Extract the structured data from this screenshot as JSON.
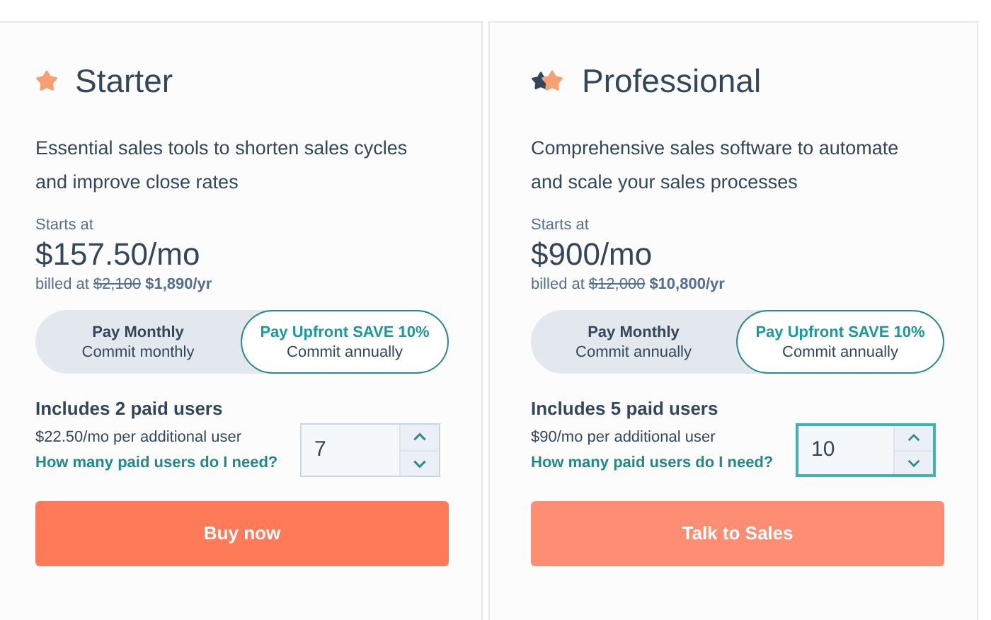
{
  "plans": [
    {
      "kind": "single",
      "name": "Starter",
      "description": "Essential sales tools to shorten sales cycles and improve close rates",
      "starts_label": "Starts at",
      "price": "$157.50/mo",
      "billed_label": "billed at",
      "old_price": "$2,100",
      "new_price": "$1,890/yr",
      "billing_options": [
        {
          "title": "Pay Monthly",
          "subtitle": "Commit monthly",
          "selected": false
        },
        {
          "title": "Pay Upfront SAVE 10%",
          "subtitle": "Commit annually",
          "selected": true
        }
      ],
      "includes": "Includes 2 paid users",
      "per_user": "$22.50/mo per additional user",
      "help_link": "How many paid users do I need?",
      "users": {
        "value": "7",
        "focused": false
      },
      "cta": {
        "label": "Buy now",
        "kind": "primary"
      }
    },
    {
      "kind": "double",
      "name": "Professional",
      "description": "Comprehensive sales software to automate and scale your sales processes",
      "starts_label": "Starts at",
      "price": "$900/mo",
      "billed_label": "billed at",
      "old_price": "$12,000",
      "new_price": "$10,800/yr",
      "billing_options": [
        {
          "title": "Pay Monthly",
          "subtitle": "Commit annually",
          "selected": false
        },
        {
          "title": "Pay Upfront SAVE 10%",
          "subtitle": "Commit annually",
          "selected": true
        }
      ],
      "includes": "Includes 5 paid users",
      "per_user": "$90/mo per additional user",
      "help_link": "How many paid users do I need?",
      "users": {
        "value": "10",
        "focused": true
      },
      "cta": {
        "label": "Talk to Sales",
        "kind": "secondary"
      }
    }
  ]
}
